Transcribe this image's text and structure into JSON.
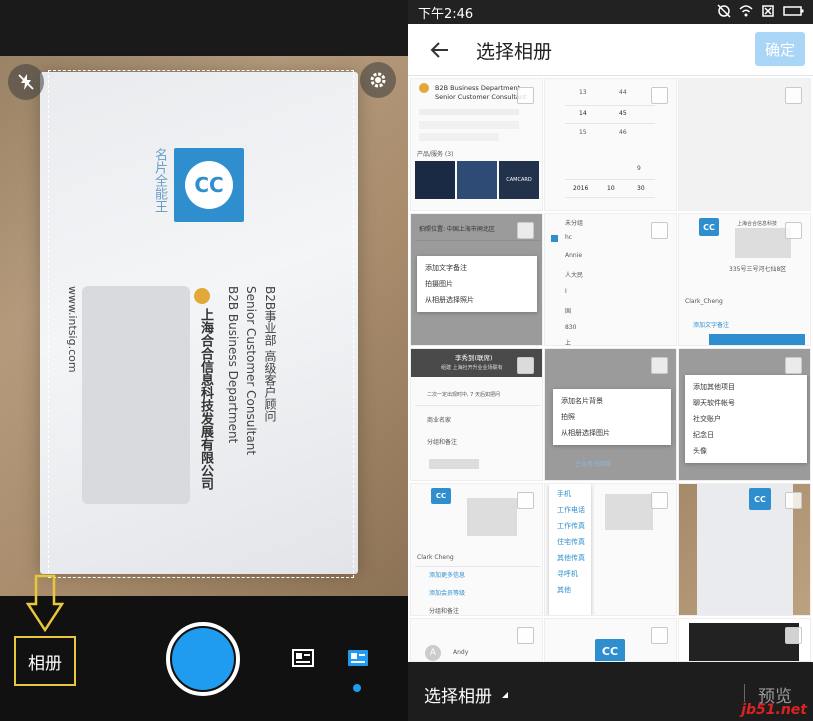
{
  "camera": {
    "flash_icon": "flash-off-icon",
    "settings_icon": "gear-icon",
    "album_button_label": "相册",
    "shutter_color": "#1f9bf0",
    "card": {
      "brand_logo_text": "CC",
      "brand_side_text": "名片全能王",
      "line1": "B2B事业部 高级客户顾问",
      "line2": "Senior Customer Consultant",
      "line3": "B2B Business Department",
      "company": "上海合合信息科技发展有限公司",
      "website": "www.intsig.com"
    },
    "mode_icons": [
      "card-mode-icon",
      "id-card-mode-icon"
    ]
  },
  "picker": {
    "status_time": "下午2:46",
    "title": "选择相册",
    "confirm_label": "确定",
    "accent_color": "#2f8fce",
    "bottom": {
      "album_select_label": "选择相册",
      "preview_label": "预览",
      "watermark": "jb51.net"
    },
    "tiles": {
      "t1": {
        "dept": "B2B Business Department",
        "role": "Senior Customer Consultant",
        "section": "产品/服务 (3)",
        "tag": "CAMCARD"
      },
      "t2": {
        "rows": [
          [
            "13",
            "44"
          ],
          [
            "14",
            "45"
          ],
          [
            "15",
            "46"
          ],
          [
            "",
            "9"
          ],
          [
            "2016",
            "10",
            "30"
          ]
        ]
      },
      "t4": {
        "line": "拍照位置: 中国上海市闸北区",
        "menu": [
          "添加文字备注",
          "拍摄图片",
          "从相册选择照片"
        ]
      },
      "t5": {
        "items": [
          "未分组",
          "hc",
          "Annie",
          "人大民",
          "I",
          "国",
          "830",
          "上"
        ]
      },
      "t6": {
        "company": "上海合合信息科技",
        "address": "335号三号河七仙8区",
        "name": "Clark_Cheng",
        "link": "添加文字备注"
      },
      "t7": {
        "name": "李秀到(联席)",
        "line": "组建 上海社开升业业场联有",
        "items": [
          "二次一定出现时中, 7 天后如把问",
          "商业名家",
          "分组和备注"
        ]
      },
      "t8": {
        "menu": [
          "添加名片背景",
          "拍照",
          "从相册选择图片"
        ],
        "foot": "已业务无网络"
      },
      "t9": {
        "menu": [
          "添加其他项目",
          "聊天软件帐号",
          "社交账户",
          "纪念日",
          "头像"
        ]
      },
      "t10": {
        "name": "Clark Cheng",
        "items": [
          "添加更多信息",
          "添加会员等级",
          "分组和备注"
        ]
      },
      "t11": {
        "menu": [
          "手机",
          "工作电话",
          "工作传真",
          "住宅传真",
          "其他传真",
          "寻呼机",
          "其他"
        ]
      },
      "t13": {
        "avatar_letter": "A",
        "name": "Andy"
      }
    }
  }
}
